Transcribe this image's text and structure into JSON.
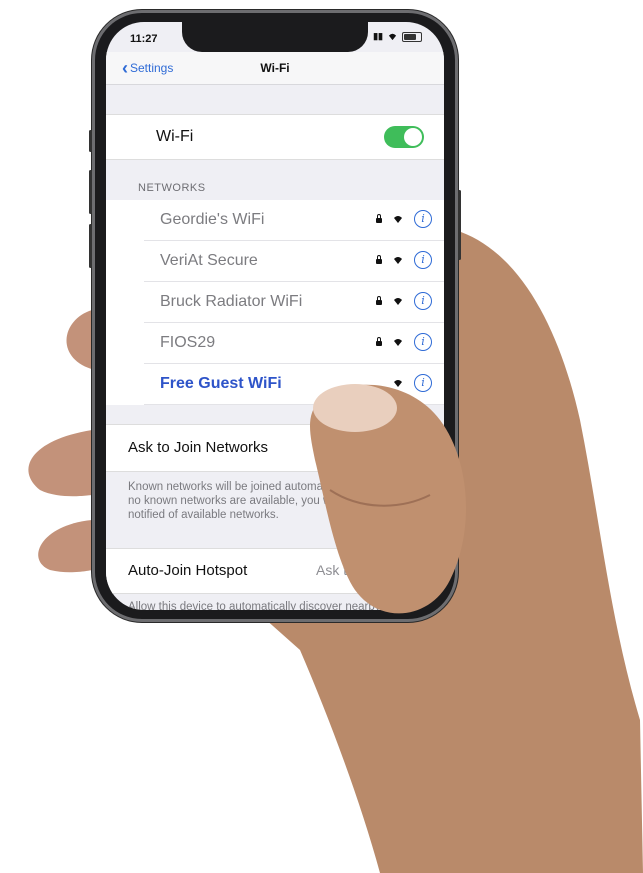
{
  "status_bar": {
    "time": "11:27"
  },
  "nav": {
    "back_label": "Settings",
    "title": "Wi-Fi"
  },
  "wifi": {
    "label": "Wi-Fi",
    "enabled": true
  },
  "networks_header": "NETWORKS",
  "networks": [
    {
      "name": "Geordie's WiFi",
      "secured": true
    },
    {
      "name": "VeriAt Secure",
      "secured": true
    },
    {
      "name": "Bruck Radiator WiFi",
      "secured": true
    },
    {
      "name": "FIOS29",
      "secured": true
    },
    {
      "name": "Free Guest WiFi",
      "secured": false
    }
  ],
  "ask_to_join": {
    "label": "Ask to Join Networks",
    "footer": "Known networks will be joined automatically. If no known networks are available, you will be notified of available networks."
  },
  "auto_join": {
    "label": "Auto-Join Hotspot",
    "value": "Ask to Join",
    "footer": "Allow this device to automatically discover nearby personal hotspots when no Wi-Fi network is available."
  },
  "colors": {
    "accent": "#2f6bd6",
    "toggle_on": "#3fbd5a",
    "guest_network": "#2e54c9"
  }
}
